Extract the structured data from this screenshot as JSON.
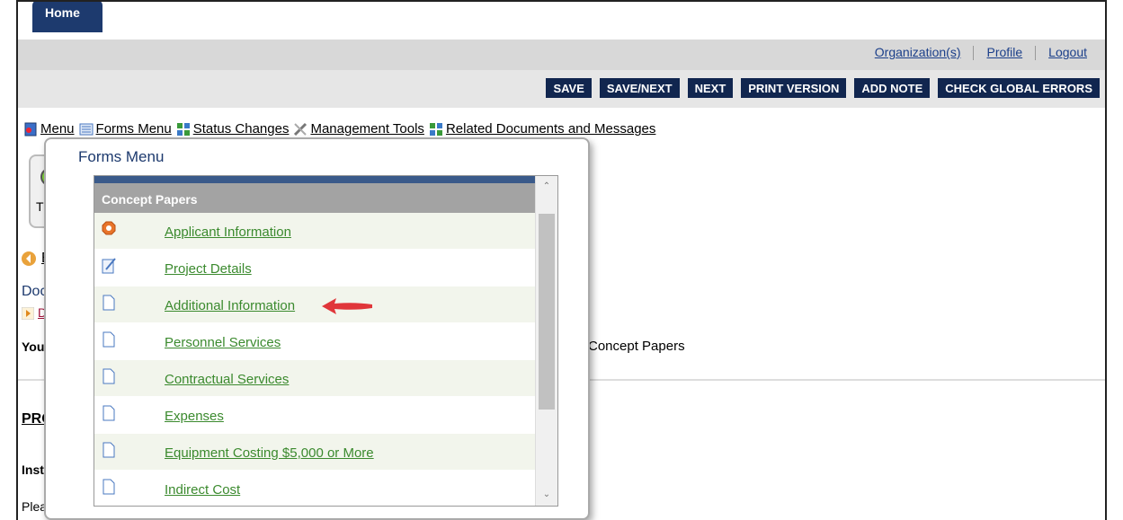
{
  "header": {
    "home_tab": "Home",
    "links": [
      "Organization(s)",
      "Profile",
      "Logout"
    ]
  },
  "toolbar": {
    "buttons": [
      "SAVE",
      "SAVE/NEXT",
      "NEXT",
      "PRINT VERSION",
      "ADD NOTE",
      "CHECK GLOBAL ERRORS"
    ]
  },
  "menu_bar": {
    "items": [
      "Menu",
      "Forms Menu",
      "Status Changes",
      "Management Tools",
      "Related Documents and Messages"
    ]
  },
  "background": {
    "card_text": "The",
    "back_text": "Ba",
    "docu_text": "Docur",
    "det_text": "Det",
    "you_are": "You ar",
    "concept_papers": "Concept Papers",
    "proj_heading": "PROJ",
    "instruc": "Instruc",
    "please": "Please"
  },
  "forms_menu": {
    "title": "Forms Menu",
    "section": "Concept Papers",
    "items": [
      {
        "label": "Applicant Information",
        "icon": "stop-sign-icon"
      },
      {
        "label": "Project Details",
        "icon": "edit-document-icon"
      },
      {
        "label": "Additional Information",
        "icon": "document-icon"
      },
      {
        "label": "Personnel Services",
        "icon": "document-icon"
      },
      {
        "label": "Contractual Services",
        "icon": "document-icon"
      },
      {
        "label": "Expenses",
        "icon": "document-icon"
      },
      {
        "label": "Equipment Costing $5,000 or More",
        "icon": "document-icon"
      },
      {
        "label": "Indirect Cost",
        "icon": "document-icon"
      }
    ]
  },
  "colors": {
    "nav_dark": "#11264f",
    "link_green": "#3b8a2e",
    "annotation_red": "#e0363a"
  }
}
